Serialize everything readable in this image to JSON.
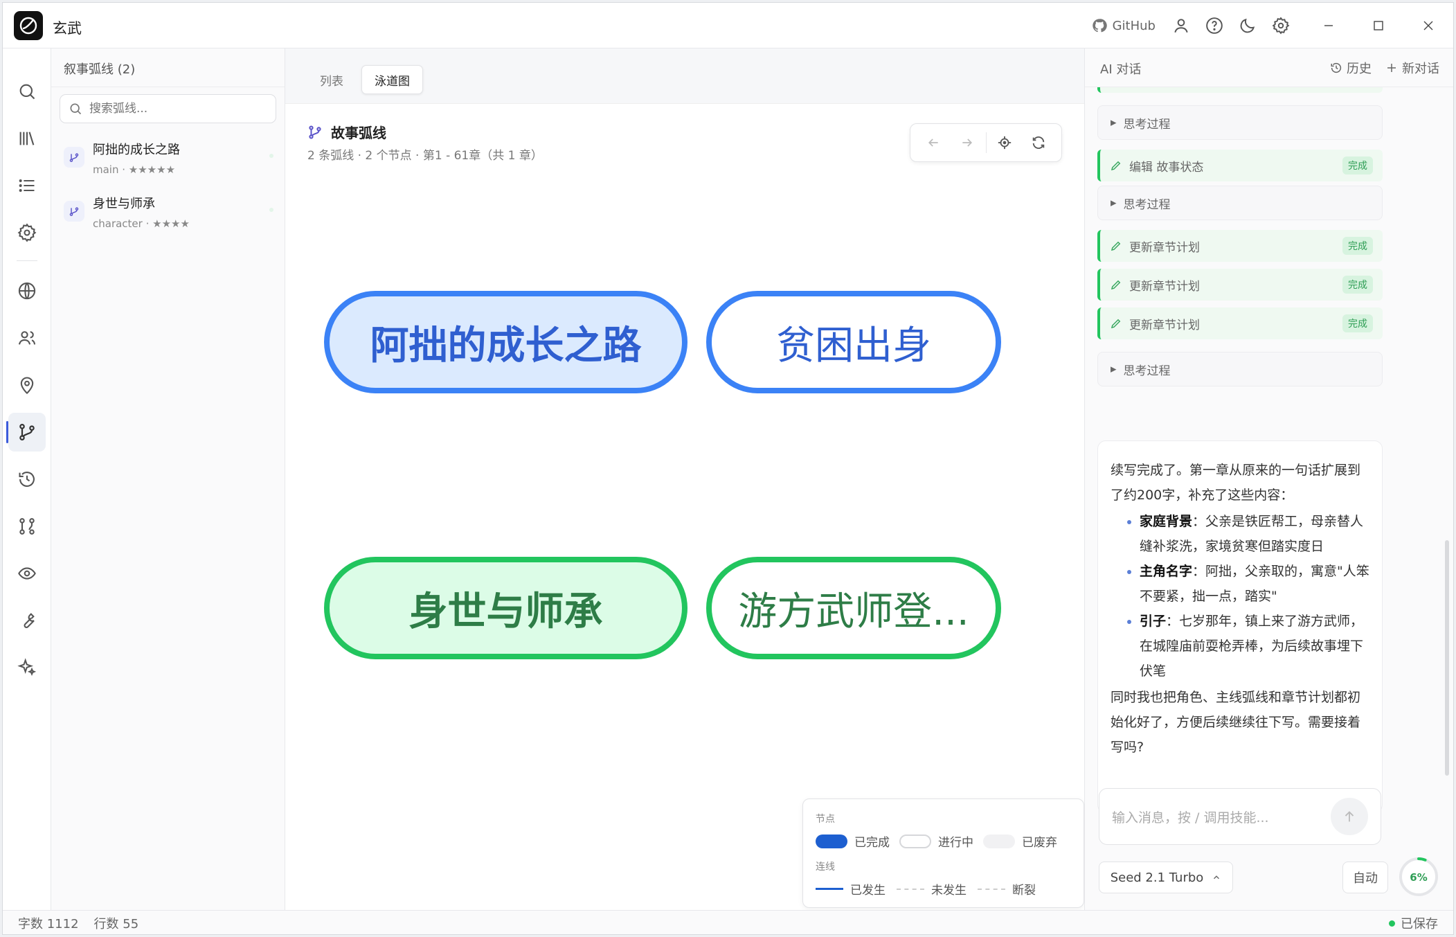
{
  "app": {
    "title": "玄武"
  },
  "titlebar": {
    "github_label": "GitHub"
  },
  "arcs_panel": {
    "header": "叙事弧线 (2)",
    "search_placeholder": "搜索弧线...",
    "items": [
      {
        "name": "阿拙的成长之路",
        "meta": "main · ★★★★★"
      },
      {
        "name": "身世与师承",
        "meta": "character · ★★★★"
      }
    ]
  },
  "center": {
    "tabs": [
      {
        "label": "列表",
        "active": false
      },
      {
        "label": "泳道图",
        "active": true
      }
    ],
    "title": "故事弧线",
    "subtitle": "2 条弧线 · 2 个节点 · 第1 - 61章（共 1 章）",
    "lanes": [
      {
        "arc_label": "阿拙的成长之路",
        "node_label": "贫困出身",
        "color": "#3b82f6"
      },
      {
        "arc_label": "身世与师承",
        "node_label": "游方武师登...",
        "color": "#22c55e"
      }
    ],
    "legend": {
      "nodes_title": "节点",
      "node_states": [
        "已完成",
        "进行中",
        "已废弃"
      ],
      "links_title": "连线",
      "link_states": [
        "已发生",
        "未发生",
        "断裂"
      ]
    }
  },
  "ai_panel": {
    "title": "AI 对话",
    "history_label": "历史",
    "new_chat_label": "新对话",
    "timeline": [
      {
        "kind": "think",
        "label": "思考过程"
      },
      {
        "kind": "tool",
        "label": "编辑 故事状态",
        "status": "完成"
      },
      {
        "kind": "think",
        "label": "思考过程"
      },
      {
        "kind": "tool",
        "label": "更新章节计划",
        "status": "完成"
      },
      {
        "kind": "tool",
        "label": "更新章节计划",
        "status": "完成"
      },
      {
        "kind": "tool",
        "label": "更新章节计划",
        "status": "完成"
      },
      {
        "kind": "think",
        "label": "思考过程"
      }
    ],
    "message": {
      "intro": "续写完成了。第一章从原来的一句话扩展到了约200字，补充了这些内容：",
      "bullets": [
        {
          "head": "家庭背景",
          "text": "：父亲是铁匠帮工，母亲替人缝补浆洗，家境贫寒但踏实度日"
        },
        {
          "head": "主角名字",
          "text": "：阿拙，父亲取的，寓意\"人笨不要紧，拙一点，踏实\""
        },
        {
          "head": "引子",
          "text": "：七岁那年，镇上来了游方武师，在城隍庙前耍枪弄棒，为后续故事埋下伏笔"
        }
      ],
      "outro": "同时我也把角色、主线弧线和章节计划都初始化好了，方便后续继续往下写。需要接着写吗?"
    },
    "composer_placeholder": "输入消息，按 / 调用技能...",
    "model": "Seed 2.1 Turbo",
    "mode": "自动",
    "context_usage": "6%",
    "context_usage_value": 0.06
  },
  "status_bar": {
    "word_count": "字数 1112",
    "line_count": "行数 55",
    "save_state": "已保存"
  },
  "colors": {
    "accent": "#3b5bdb",
    "arc_blue": "#3b82f6",
    "arc_green": "#22c55e",
    "done": "#1d5fd0"
  }
}
